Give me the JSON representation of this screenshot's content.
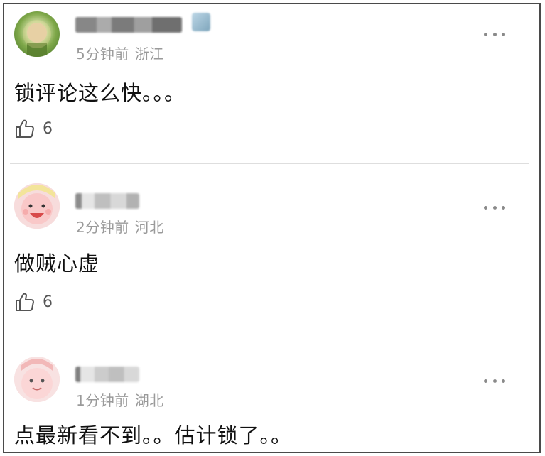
{
  "comments": [
    {
      "time": "5分钟前",
      "location": "浙江",
      "text": "锁评论这么快。。。",
      "likes": "6",
      "avatar_icon": "green-photo-avatar"
    },
    {
      "time": "2分钟前",
      "location": "河北",
      "text": "做贼心虚",
      "likes": "6",
      "avatar_icon": "pink-cartoon-avatar"
    },
    {
      "time": "1分钟前",
      "location": "湖北",
      "text": "点最新看不到。。估计锁了。。",
      "likes": "",
      "avatar_icon": "pink-cartoon-avatar"
    }
  ],
  "icons": {
    "like": "thumbs-up-icon",
    "more": "more-dots-icon"
  },
  "colors": {
    "meta_text": "#9a9a9a",
    "body_text": "#111111",
    "divider": "#dedede",
    "border": "#4a4a4a"
  }
}
